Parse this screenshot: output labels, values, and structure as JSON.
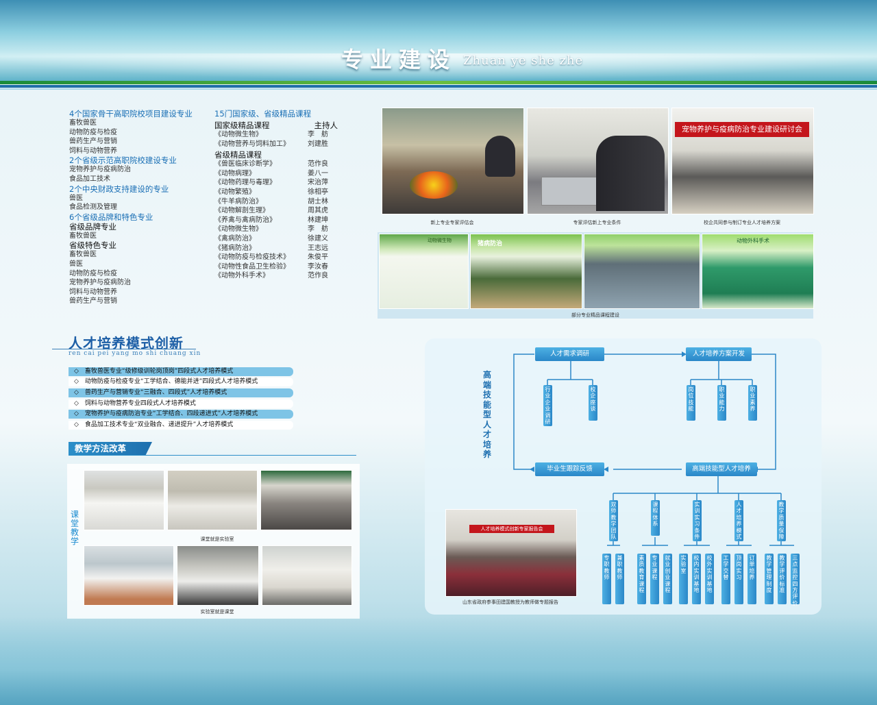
{
  "header": {
    "title": "专业建设",
    "subtitle": "Zhuan ye she zhe"
  },
  "left_column": {
    "groups": [
      {
        "heading": "4个国家骨干高职院校项目建设专业",
        "items": [
          "畜牧兽医",
          "动物防疫与检疫",
          "兽药生产与营销",
          "饲料与动物营养"
        ]
      },
      {
        "heading": "2个省级示范高职院校建设专业",
        "items": [
          "宠物养护与疫病防治",
          "食品加工技术"
        ]
      },
      {
        "heading": "2个中央财政支持建设的专业",
        "items": [
          "兽医",
          "食品检测及管理"
        ]
      },
      {
        "heading": "6个省级品牌和特色专业",
        "items": []
      }
    ],
    "brand_heading": "省级品牌专业",
    "brand_items": [
      "畜牧兽医"
    ],
    "special_heading": "省级特色专业",
    "special_items": [
      "畜牧兽医",
      "兽医",
      "动物防疫与检疫",
      "宠物养护与疫病防治",
      "饲料与动物营养",
      "兽药生产与营销"
    ]
  },
  "courses": {
    "heading": "15门国家级、省级精品课程",
    "national_heading": "国家级精品课程",
    "host_heading": "主持人",
    "national": [
      {
        "name": "《动物微生物》",
        "host": "李　舫"
      },
      {
        "name": "《动物营养与饲料加工》",
        "host": "刘建胜"
      }
    ],
    "provincial_heading": "省级精品课程",
    "provincial": [
      {
        "name": "《兽医临床诊断学》",
        "host": "范作良"
      },
      {
        "name": "《动物病理》",
        "host": "姜八一"
      },
      {
        "name": "《动物药理与毒理》",
        "host": "宋治萍"
      },
      {
        "name": "《动物繁殖》",
        "host": "徐相亭"
      },
      {
        "name": "《牛羊病防治》",
        "host": "胡士林"
      },
      {
        "name": "《动物解剖生理》",
        "host": "周其虎"
      },
      {
        "name": "《养禽与禽病防治》",
        "host": "林建坤"
      },
      {
        "name": "《动物微生物》",
        "host": "李　舫"
      },
      {
        "name": "《禽病防治》",
        "host": "徐建义"
      },
      {
        "name": "《猪病防治》",
        "host": "王志远"
      },
      {
        "name": "《动物防疫与检疫技术》",
        "host": "朱俊平"
      },
      {
        "name": "《动物性食品卫生检验》",
        "host": "李汝春"
      },
      {
        "name": "《动物外科手术》",
        "host": "范作良"
      }
    ]
  },
  "photos_top": {
    "captions": [
      "新上专业专家评估会",
      "专家评估新上专业条件",
      "校企共同参与制订专业人才培养方案"
    ],
    "banner_text": "宠物养护与疫病防治专业建设研讨会",
    "web_caption": "部分专业精品课程建设",
    "web_titles": [
      "动物微生物",
      "猪病防治",
      "动物外科手术"
    ]
  },
  "talent": {
    "title": "人才培养模式创新",
    "pinyin": "ren cai pei yang mo shi chuang xin",
    "modes": [
      "◇　畜牧兽医专业“级修级训轮岗顶岗”四段式人才培养模式",
      "◇　动物防疫与检疫专业“工学结合、德能并进”四段式人才培养模式",
      "◇　兽药生产与营销专业“三融合、四段式”人才培养模式",
      "◇　饲料与动物营养专业四段式人才培养模式",
      "◇　宠物养护与疫病防治专业“工学结合、四段递进式”人才培养模式",
      "◇　食品加工技术专业“双业融合、递进提升”人才培养模式"
    ]
  },
  "method": {
    "title": "教学方法改革",
    "side_label": "课堂教学",
    "captions": [
      "课堂就是实验室",
      "实验室就是课堂"
    ]
  },
  "diagram": {
    "vertical_title": "高端技能型人才培养",
    "top_left": "人才需求调研",
    "top_right": "人才培养方案开发",
    "left_children": [
      "行业企业调研",
      "校企座谈"
    ],
    "right_children": [
      "岗位技能",
      "职业能力",
      "职业素养"
    ],
    "bottom_left": "毕业生跟踪反馈",
    "bottom_right": "高端技能型人才培养",
    "branches": [
      {
        "label": "双师教学团队",
        "children": [
          "专职教师",
          "兼职教师"
        ]
      },
      {
        "label": "课程体系",
        "children": [
          "素质教育课程",
          "专业课程",
          "就业创业课程"
        ]
      },
      {
        "label": "实训实习条件",
        "children": [
          "实验室",
          "校内实训基地",
          "校外实训基地"
        ]
      },
      {
        "label": "人才培养模式",
        "children": [
          "工学交替",
          "顶岗实习",
          "订单培养"
        ]
      },
      {
        "label": "教学质量保障",
        "children": [
          "教学管理制度",
          "教学评价标准",
          "三点监控四方评价"
        ]
      }
    ],
    "photo_banner": "人才培养模式创新专家报告会",
    "photo_caption": "山东省政府参事田建国教授为教师做专题报告"
  },
  "colors": {
    "accent": "#1a6fb5",
    "node": "#2a87c8",
    "stripe_green": "#1a8b3a"
  }
}
